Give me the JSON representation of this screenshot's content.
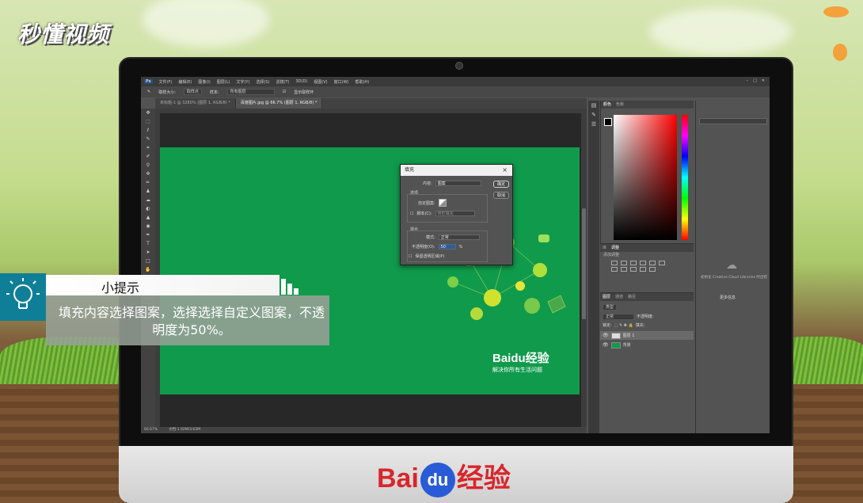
{
  "brand_logo": "秒懂视频",
  "bezel_logo": {
    "bai": "Bai",
    "du": "du",
    "jingyan": "经验"
  },
  "photoshop": {
    "app_badge": "Ps",
    "menu": [
      "文件(F)",
      "编辑(E)",
      "图像(I)",
      "图层(L)",
      "文字(Y)",
      "选择(S)",
      "滤镜(T)",
      "3D(D)",
      "视图(V)",
      "窗口(W)",
      "帮助(H)"
    ],
    "options": {
      "size_label": "取样大小:",
      "size_value": "取样点",
      "sample_label": "样本:",
      "sample_value": "所有图层",
      "ring_label": "显示取样环"
    },
    "tabs": [
      "未标题-1 @ 3280% (图层 1, RGB/8) *",
      "百度图片.jpg @ 66.7% (图层 1, RGB/8) *"
    ],
    "tools": [
      "✥",
      "⬚",
      "ℓ",
      "✎",
      "⌗",
      "✐",
      "⚲",
      "✜",
      "✏",
      "♟",
      "☁",
      "◐",
      "▲",
      "◉",
      "✒",
      "T",
      "➤",
      "□",
      "✋",
      "🔍"
    ],
    "status": {
      "zoom": "66.67%",
      "doc": "文档:1.92M/3.63M"
    },
    "canvas": {
      "brand_bai": "Bai",
      "brand_du": "du",
      "brand_jingyan": "经验",
      "slogan": "解决你所有生活问题"
    },
    "panels": {
      "color_tabs": [
        "颜色",
        "色板"
      ],
      "adjust_tabs": [
        "库",
        "调整"
      ],
      "adjust_label": "添加调整",
      "layers_tabs": [
        "图层",
        "通道",
        "路径"
      ],
      "layers_kind": "类型",
      "blend_mode": "正常",
      "opacity_label": "不透明度:",
      "lock_label": "锁定:",
      "fill_label": "填充:",
      "layers": [
        {
          "name": "图层 1"
        },
        {
          "name": "背景"
        }
      ],
      "libs_text": "初始化 Creative Cloud Libraries 时出错",
      "libs_more": "更多信息"
    },
    "fill_dialog": {
      "title": "填充",
      "content_label": "内容:",
      "content_value": "图案",
      "ok": "确定",
      "cancel": "取消",
      "options_label": "选项",
      "custom_pattern_label": "自定图案:",
      "script_label": "脚本(C):",
      "script_value": "砖形填充",
      "blend_label": "混合",
      "mode_label": "模式:",
      "mode_value": "正常",
      "opacity_label": "不透明度(O):",
      "opacity_value": "50",
      "opacity_unit": "%",
      "preserve_label": "保留透明区域(P)"
    }
  },
  "tip": {
    "title": "小提示",
    "text": "填充内容选择图案，选择选择自定义图案，不透明度为50%。"
  }
}
